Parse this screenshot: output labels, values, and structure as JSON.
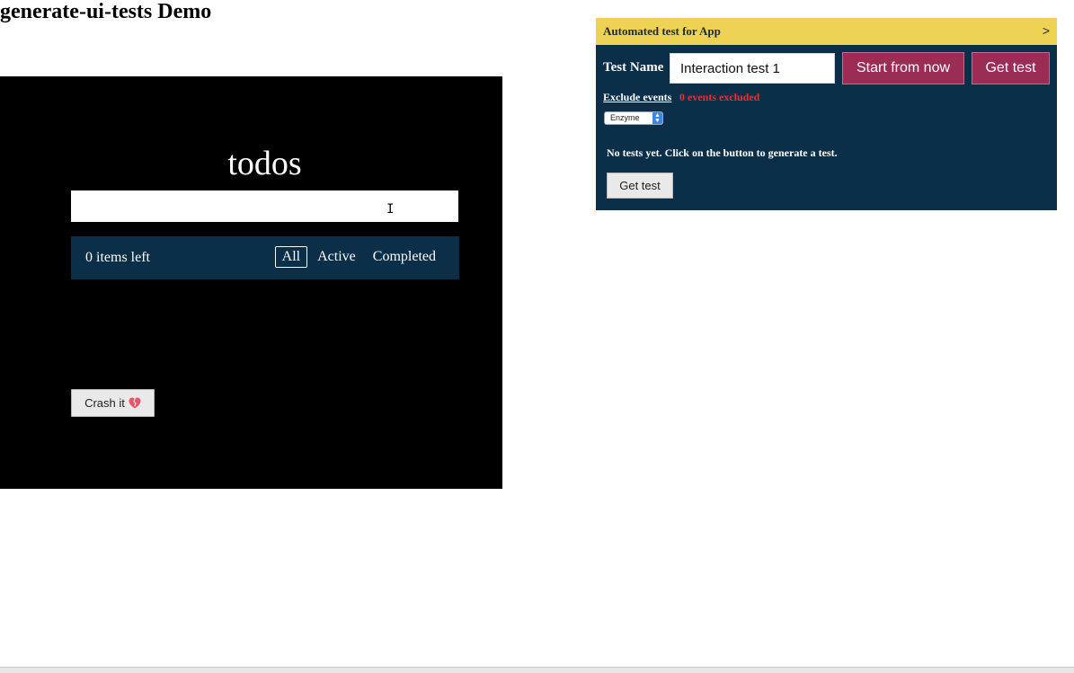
{
  "page": {
    "title": "generate-ui-tests Demo"
  },
  "todo": {
    "header": "todos",
    "new_todo": {
      "value": "",
      "placeholder": ""
    },
    "items_left": "0 items left",
    "filters": [
      {
        "label": "All",
        "selected": true
      },
      {
        "label": "Active",
        "selected": false
      },
      {
        "label": "Completed",
        "selected": false
      }
    ],
    "crash_button_label": "Crash it",
    "crash_icon": "broken-heart-icon"
  },
  "test_panel": {
    "title": "Automated test for App",
    "collapse_glyph": ">",
    "test_name_label": "Test Name",
    "test_name_value": "Interaction test 1",
    "start_button_label": "Start from now",
    "get_test_label": "Get test",
    "exclude_events_label": "Exclude events",
    "events_excluded": "0 events excluded",
    "framework_selected": "Enzyme",
    "no_tests_message": "No tests yet. Click on the button to generate a test.",
    "get_test_bottom_label": "Get test"
  },
  "colors": {
    "panel_header": "#edd253",
    "panel_background": "#0b2e49",
    "accent_button": "#9b2c55",
    "excluded_text": "#ff2a2a",
    "todo_background": "#000000"
  }
}
